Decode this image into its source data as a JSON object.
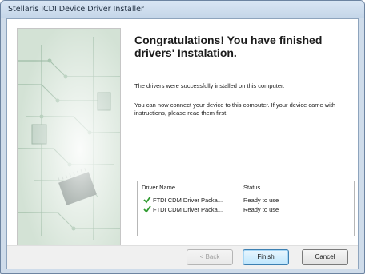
{
  "window": {
    "title": "Stellaris ICDI Device Driver Installer"
  },
  "main": {
    "heading": "Congratulations! You have finished drivers' Instalation.",
    "message_installed": "The drivers were successfully installed on this computer.",
    "message_connect": "You can now connect your device to this computer. If your device came with instructions, please read them first."
  },
  "driver_list": {
    "columns": [
      "Driver Name",
      "Status"
    ],
    "rows": [
      {
        "name": "FTDI CDM Driver Packa...",
        "status": "Ready to use",
        "icon": "green-check-icon"
      },
      {
        "name": "FTDI CDM Driver Packa...",
        "status": "Ready to use",
        "icon": "green-check-icon"
      }
    ]
  },
  "buttons": {
    "back": "< Back",
    "finish": "Finish",
    "cancel": "Cancel"
  },
  "colors": {
    "check": "#2e9a2e",
    "title_bar": "#c8d8ea",
    "default_button": "#3c7fb1"
  }
}
